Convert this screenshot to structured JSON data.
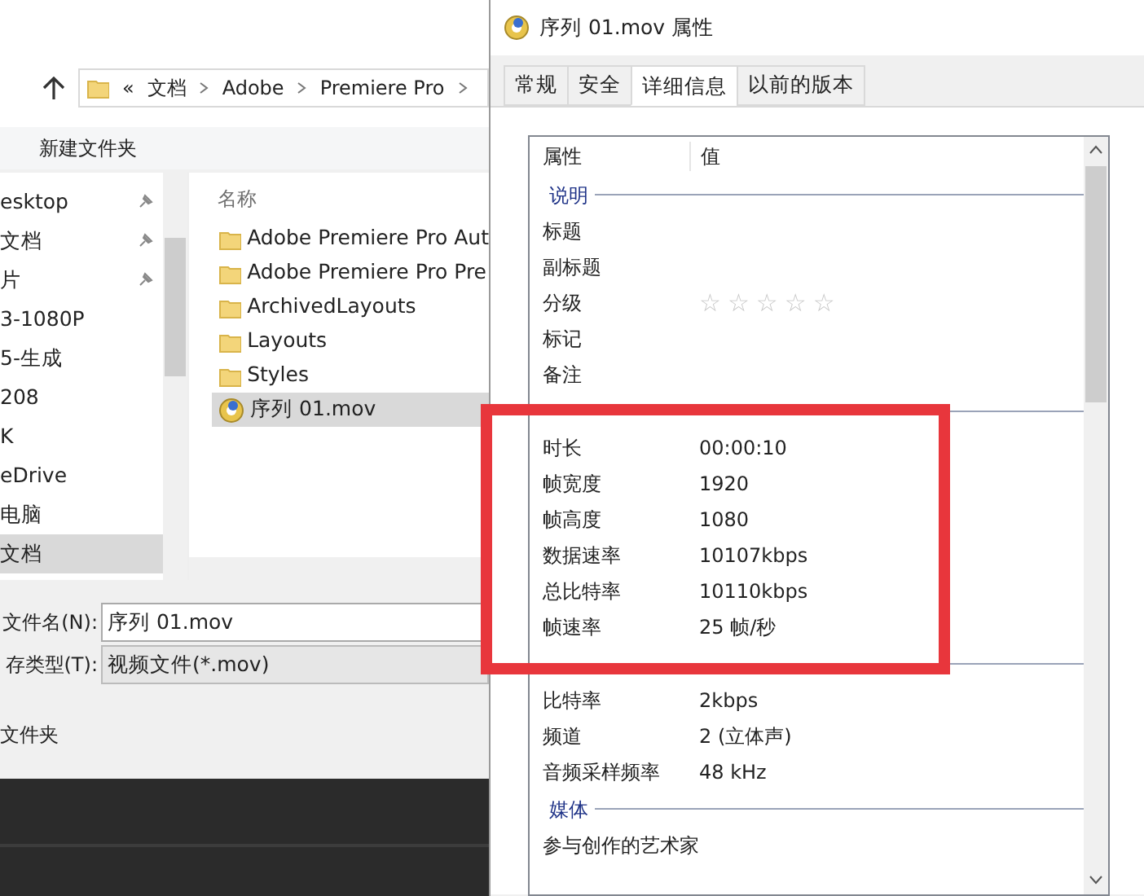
{
  "explorer": {
    "breadcrumb": [
      "«",
      "文档",
      "Adobe",
      "Premiere Pro"
    ],
    "toolbar": [
      "新建文件夹"
    ],
    "nav_items": [
      {
        "label": "esktop",
        "pinned": true,
        "selected": false
      },
      {
        "label": "文档",
        "pinned": true,
        "selected": false
      },
      {
        "label": "片",
        "pinned": true,
        "selected": false
      },
      {
        "label": "3-1080P",
        "pinned": false,
        "selected": false
      },
      {
        "label": "5-生成",
        "pinned": false,
        "selected": false
      },
      {
        "label": "208",
        "pinned": false,
        "selected": false
      },
      {
        "label": "K",
        "pinned": false,
        "selected": false
      },
      {
        "label": "eDrive",
        "pinned": false,
        "selected": false
      },
      {
        "label": "电脑",
        "pinned": false,
        "selected": false
      },
      {
        "label": "文档",
        "pinned": false,
        "selected": true
      }
    ],
    "files": {
      "column": "名称",
      "items": [
        {
          "name": "Adobe Premiere Pro Aut",
          "kind": "folder",
          "selected": false
        },
        {
          "name": "Adobe Premiere Pro Pre",
          "kind": "folder",
          "selected": false
        },
        {
          "name": "ArchivedLayouts",
          "kind": "folder",
          "selected": false
        },
        {
          "name": "Layouts",
          "kind": "folder",
          "selected": false
        },
        {
          "name": "Styles",
          "kind": "folder",
          "selected": false
        },
        {
          "name": "序列 01.mov",
          "kind": "video",
          "selected": true
        }
      ]
    },
    "filename_label": "文件名(N):",
    "filename": "序列 01.mov",
    "type_label": "存类型(T):",
    "type_value": "视频文件(*.mov)",
    "folders_toggle": "文件夹"
  },
  "properties": {
    "title": "序列 01.mov 属性",
    "tabs": [
      {
        "label": "常规",
        "selected": false
      },
      {
        "label": "安全",
        "selected": false
      },
      {
        "label": "详细信息",
        "selected": true
      },
      {
        "label": "以前的版本",
        "selected": false
      }
    ],
    "columns": [
      "属性",
      "值"
    ],
    "sections": [
      {
        "title": "说明",
        "rows": [
          {
            "name": "标题",
            "kind": "text"
          },
          {
            "name": "副标题",
            "kind": "text"
          },
          {
            "name": "分级",
            "kind": "rating",
            "stars": 0
          },
          {
            "name": "标记",
            "kind": "text"
          },
          {
            "name": "备注",
            "kind": "text"
          }
        ]
      },
      {
        "rows": [
          {
            "name": "时长",
            "kind": "text",
            "value": "00:00:10"
          },
          {
            "name": "帧宽度",
            "kind": "text",
            "value": "1920"
          },
          {
            "name": "帧高度",
            "kind": "text",
            "value": "1080"
          },
          {
            "name": "数据速率",
            "kind": "text",
            "value": "10107kbps"
          },
          {
            "name": "总比特率",
            "kind": "text",
            "value": "10110kbps"
          },
          {
            "name": "帧速率",
            "kind": "text",
            "value": "25 帧/秒"
          }
        ]
      },
      {
        "rows": [
          {
            "name": "比特率",
            "kind": "text",
            "value": "2kbps"
          },
          {
            "name": "频道",
            "kind": "text",
            "value": "2 (立体声)"
          },
          {
            "name": "音频采样频率",
            "kind": "text",
            "value": "48 kHz"
          }
        ]
      },
      {
        "title": "媒体",
        "rows": [
          {
            "name": "参与创作的艺术家",
            "kind": "text"
          }
        ]
      }
    ]
  }
}
